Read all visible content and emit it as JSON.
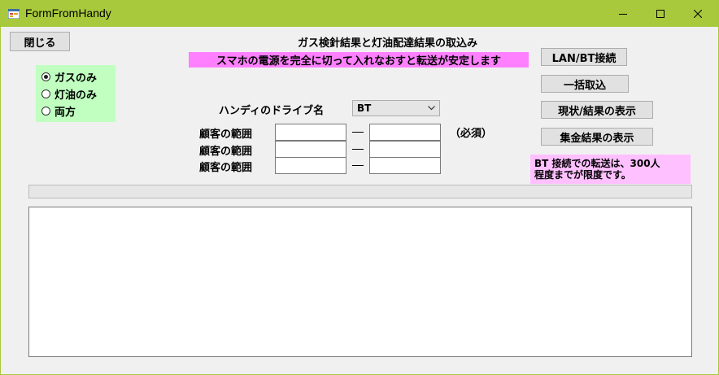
{
  "window": {
    "title": "FormFromHandy"
  },
  "close_button_label": "閉じる",
  "heading": "ガス検針結果と灯油配達結果の取込み",
  "notice": "スマホの電源を完全に切って入れなおすと転送が安定します",
  "radio_group": {
    "options": [
      "ガスのみ",
      "灯油のみ",
      "両方"
    ],
    "selected_index": 0
  },
  "drive": {
    "label": "ハンディのドライブ名",
    "value": "BT"
  },
  "ranges": {
    "label": "顧客の範囲",
    "required_note": "（必須）"
  },
  "buttons": {
    "connect": "LAN/BT接続",
    "import_all": "一括取込",
    "show_status": "現状/結果の表示",
    "show_totals": "集金結果の表示"
  },
  "bt_note": {
    "line1": "BT 接続での転送は、300人",
    "line2": "程度までが限度です。"
  },
  "colors": {
    "titlebar": "#a9c93d",
    "notice_bg": "#ff80ff",
    "radio_panel_bg": "#c0ffc0",
    "bt_note_bg": "#ffc0ff"
  },
  "icons": {
    "app": "form-app-icon",
    "minimize": "minimize-icon",
    "maximize": "maximize-icon",
    "close": "close-icon",
    "dropdown": "chevron-down-icon"
  }
}
